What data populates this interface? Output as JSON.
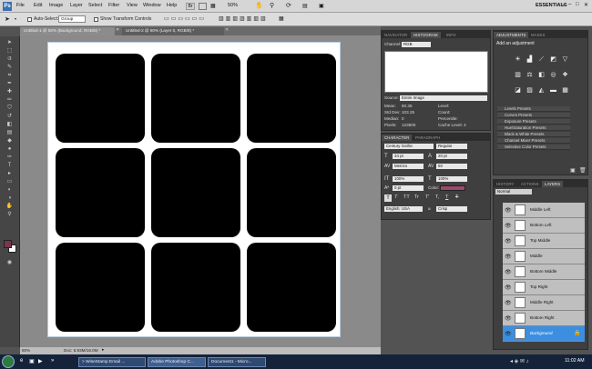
{
  "menubar": {
    "items": [
      "File",
      "Edit",
      "Image",
      "Layer",
      "Select",
      "Filter",
      "View",
      "Window",
      "Help"
    ],
    "zoom": "50%",
    "workspace": "ESSENTIALS"
  },
  "options": {
    "auto_select_label": "Auto-Select:",
    "auto_select_value": "Group",
    "transform_label": "Show Transform Controls"
  },
  "tabs": [
    {
      "label": "Untitled-1 @ 50% (Background, RGB/8) *"
    },
    {
      "label": "Untitled-2 @ 50% (Layer 0, RGB/8) *"
    }
  ],
  "status": {
    "zoom": "50%",
    "doc": "Doc: 5.93M/16.0M"
  },
  "navigator": {
    "tabs": [
      "NAVIGATOR",
      "HISTOGRAM",
      "INFO"
    ],
    "channel_label": "Channel:",
    "channel_value": "RGB",
    "source_label": "Source:",
    "source_value": "Entire Image",
    "stats_left": [
      {
        "label": "Mean:",
        "value": "50.35"
      },
      {
        "label": "Std Dev:",
        "value": "103.25"
      },
      {
        "label": "Median:",
        "value": "0"
      },
      {
        "label": "Pixels:",
        "value": "123800"
      }
    ],
    "stats_right": [
      "Level:",
      "Count:",
      "Percentile:",
      "Cache Level: 4"
    ]
  },
  "character": {
    "tabs": [
      "CHARACTER",
      "PARAGRAPH"
    ],
    "font": "Century Gothic",
    "style": "Regular",
    "size": "34 pt",
    "leading": "20 pt",
    "kerning": "Metrics",
    "tracking": "50",
    "vscale": "100%",
    "hscale": "100%",
    "baseline": "0 pt",
    "color_label": "Color:",
    "type_buttons": [
      "T",
      "T",
      "TT",
      "Tr",
      "T'",
      "T,",
      "T",
      "T"
    ],
    "language": "English: USA",
    "aa_label": "a",
    "aa_value": "Crisp"
  },
  "adjustments": {
    "tabs": [
      "ADJUSTMENTS",
      "MASKS"
    ],
    "title": "Add an adjustment",
    "presets": [
      "Levels Presets",
      "Curves Presets",
      "Exposure Presets",
      "Hue/Saturation Presets",
      "Black & White Presets",
      "Channel Mixer Presets",
      "Selective Color Presets"
    ]
  },
  "layers": {
    "tabs": [
      "HISTORY",
      "ACTIONS",
      "LAYERS"
    ],
    "blend": "Normal",
    "items": [
      {
        "name": "Middle Left"
      },
      {
        "name": "Bottom Left"
      },
      {
        "name": "Top Middle"
      },
      {
        "name": "Middle"
      },
      {
        "name": "Bottom Middle"
      },
      {
        "name": "Top Right"
      },
      {
        "name": "Middle Right"
      },
      {
        "name": "Bottom Right"
      },
      {
        "name": "Background"
      }
    ]
  },
  "taskbar": {
    "tasks": [
      "> WiseStamp Email ...",
      "Adobe Photoshop C...",
      "Document1 - Micro..."
    ],
    "clock": "11:02 AM"
  },
  "colors": {
    "foreground": "#7a3550",
    "background": "#ffffff",
    "layer_selected": "#3c8fe0",
    "text_color": "#9c4a6a"
  }
}
